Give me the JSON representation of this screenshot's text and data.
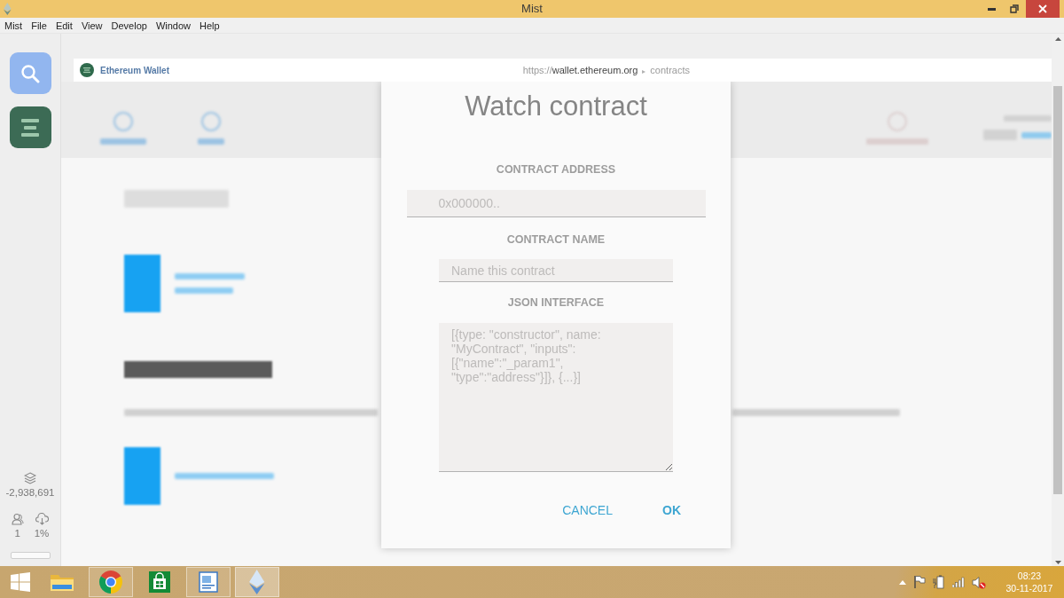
{
  "window": {
    "title": "Mist"
  },
  "menu_bar": [
    "Mist",
    "File",
    "Edit",
    "View",
    "Develop",
    "Window",
    "Help"
  ],
  "sidebar": {
    "block_number": "-2,938,691",
    "peers": "1",
    "sync_percent": "1%",
    "sync_progress": {
      "level": 0
    }
  },
  "address_bar": {
    "site_name": "Ethereum Wallet",
    "url_scheme": "https://",
    "url_host": "wallet.ethereum.org",
    "url_separator": "▸",
    "url_path": "contracts"
  },
  "dialog": {
    "title": "Watch contract",
    "fields": [
      {
        "kind": "address",
        "label": "CONTRACT ADDRESS",
        "placeholder": "0x000000.."
      },
      {
        "kind": "text",
        "label": "CONTRACT NAME",
        "placeholder": "Name this contract"
      },
      {
        "kind": "textarea",
        "label": "JSON INTERFACE",
        "placeholder": "[{type: \"constructor\", name: \"MyContract\", \"inputs\": [{\"name\":\"_param1\", \"type\":\"address\"}]}, {...}]"
      }
    ],
    "buttons": [
      {
        "label": "CANCEL",
        "primary": false
      },
      {
        "label": "OK",
        "primary": true
      }
    ]
  },
  "taskbar": {
    "apps": [
      {
        "kind": "explorer",
        "running": false,
        "selected": false
      },
      {
        "kind": "browser",
        "running": true,
        "selected": false
      },
      {
        "kind": "store",
        "running": false,
        "selected": false
      },
      {
        "kind": "document",
        "running": true,
        "selected": false
      },
      {
        "kind": "mist",
        "running": true,
        "selected": true
      }
    ],
    "time": "08:23",
    "date": "30-11-2017"
  }
}
